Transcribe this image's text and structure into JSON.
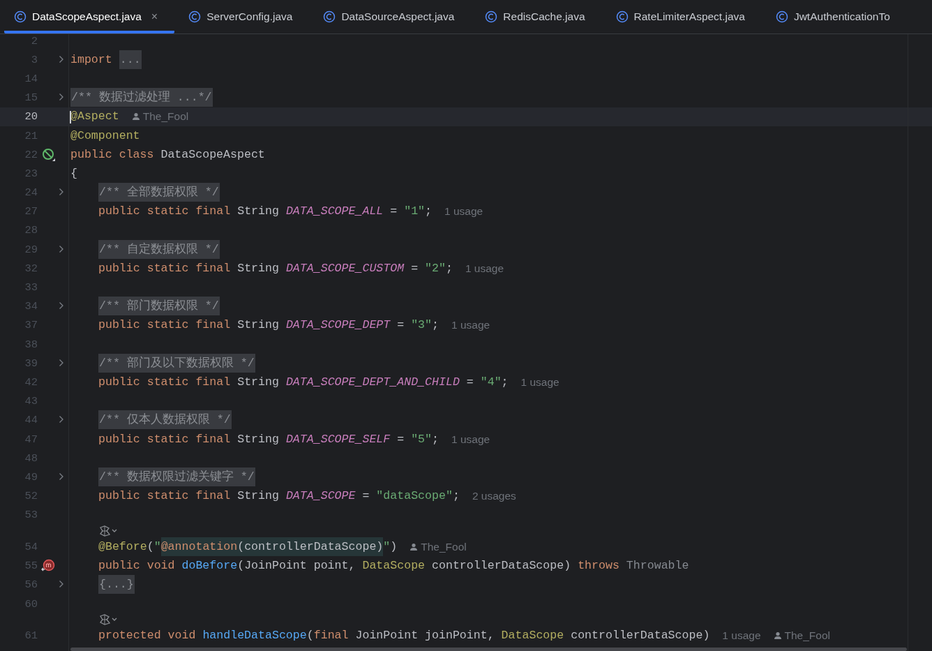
{
  "tabs": [
    {
      "label": "DataScopeAspect.java",
      "selected": true,
      "close": "×"
    },
    {
      "label": "ServerConfig.java",
      "selected": false
    },
    {
      "label": "DataSourceAspect.java",
      "selected": false
    },
    {
      "label": "RedisCache.java",
      "selected": false
    },
    {
      "label": "RateLimiterAspect.java",
      "selected": false
    },
    {
      "label": "JwtAuthenticationTo",
      "selected": false
    }
  ],
  "editor": {
    "lines": [
      {
        "kind": "code",
        "number": "2",
        "current": false
      },
      {
        "kind": "code",
        "number": "3",
        "current": false,
        "indented": false,
        "gutter": {
          "kind": "fold"
        },
        "tokens": [
          {
            "kind": "kw",
            "text": "import "
          },
          {
            "kind": "fold",
            "text": "..."
          }
        ]
      },
      {
        "kind": "code",
        "number": "14",
        "current": false
      },
      {
        "kind": "code",
        "number": "15",
        "current": false,
        "indented": false,
        "gutter": {
          "kind": "fold"
        },
        "tokens": [
          {
            "kind": "fold",
            "text": "/** 数据过滤处理 ...*/"
          }
        ]
      },
      {
        "kind": "code",
        "number": "20",
        "current": true,
        "indented": false,
        "tokens": [
          {
            "kind": "ann",
            "text": "@Aspect"
          },
          {
            "kind": "author",
            "text": "The_Fool"
          }
        ]
      },
      {
        "kind": "code",
        "number": "21",
        "current": false,
        "indented": false,
        "tokens": [
          {
            "kind": "ann",
            "text": "@Component"
          }
        ]
      },
      {
        "kind": "code",
        "number": "22",
        "current": false,
        "indented": false,
        "gutter": {
          "kind": "bean"
        },
        "tokens": [
          {
            "kind": "kw",
            "text": "public class "
          },
          {
            "kind": "plain",
            "text": "DataScopeAspect"
          }
        ]
      },
      {
        "kind": "code",
        "number": "23",
        "current": false,
        "indented": false,
        "tokens": [
          {
            "kind": "plain",
            "text": "{"
          }
        ]
      },
      {
        "kind": "code",
        "number": "24",
        "current": false,
        "indented": true,
        "gutter": {
          "kind": "fold"
        },
        "tokens": [
          {
            "kind": "fold",
            "text": "/** 全部数据权限 */"
          }
        ]
      },
      {
        "kind": "code",
        "number": "27",
        "current": false,
        "indented": true,
        "tokens": [
          {
            "kind": "kw",
            "text": "public static final "
          },
          {
            "kind": "plain",
            "text": "String "
          },
          {
            "kind": "const",
            "text": "DATA_SCOPE_ALL"
          },
          {
            "kind": "plain",
            "text": " = "
          },
          {
            "kind": "str",
            "text": "\"1\""
          },
          {
            "kind": "plain",
            "text": ";"
          },
          {
            "kind": "hint",
            "text": "1 usage"
          }
        ]
      },
      {
        "kind": "code",
        "number": "28",
        "current": false
      },
      {
        "kind": "code",
        "number": "29",
        "current": false,
        "indented": true,
        "gutter": {
          "kind": "fold"
        },
        "tokens": [
          {
            "kind": "fold",
            "text": "/** 自定数据权限 */"
          }
        ]
      },
      {
        "kind": "code",
        "number": "32",
        "current": false,
        "indented": true,
        "tokens": [
          {
            "kind": "kw",
            "text": "public static final "
          },
          {
            "kind": "plain",
            "text": "String "
          },
          {
            "kind": "const",
            "text": "DATA_SCOPE_CUSTOM"
          },
          {
            "kind": "plain",
            "text": " = "
          },
          {
            "kind": "str",
            "text": "\"2\""
          },
          {
            "kind": "plain",
            "text": ";"
          },
          {
            "kind": "hint",
            "text": "1 usage"
          }
        ]
      },
      {
        "kind": "code",
        "number": "33",
        "current": false
      },
      {
        "kind": "code",
        "number": "34",
        "current": false,
        "indented": true,
        "gutter": {
          "kind": "fold"
        },
        "tokens": [
          {
            "kind": "fold",
            "text": "/** 部门数据权限 */"
          }
        ]
      },
      {
        "kind": "code",
        "number": "37",
        "current": false,
        "indented": true,
        "tokens": [
          {
            "kind": "kw",
            "text": "public static final "
          },
          {
            "kind": "plain",
            "text": "String "
          },
          {
            "kind": "const",
            "text": "DATA_SCOPE_DEPT"
          },
          {
            "kind": "plain",
            "text": " = "
          },
          {
            "kind": "str",
            "text": "\"3\""
          },
          {
            "kind": "plain",
            "text": ";"
          },
          {
            "kind": "hint",
            "text": "1 usage"
          }
        ]
      },
      {
        "kind": "code",
        "number": "38",
        "current": false
      },
      {
        "kind": "code",
        "number": "39",
        "current": false,
        "indented": true,
        "gutter": {
          "kind": "fold"
        },
        "tokens": [
          {
            "kind": "fold",
            "text": "/** 部门及以下数据权限 */"
          }
        ]
      },
      {
        "kind": "code",
        "number": "42",
        "current": false,
        "indented": true,
        "tokens": [
          {
            "kind": "kw",
            "text": "public static final "
          },
          {
            "kind": "plain",
            "text": "String "
          },
          {
            "kind": "const",
            "text": "DATA_SCOPE_DEPT_AND_CHILD"
          },
          {
            "kind": "plain",
            "text": " = "
          },
          {
            "kind": "str",
            "text": "\"4\""
          },
          {
            "kind": "plain",
            "text": ";"
          },
          {
            "kind": "hint",
            "text": "1 usage"
          }
        ]
      },
      {
        "kind": "code",
        "number": "43",
        "current": false
      },
      {
        "kind": "code",
        "number": "44",
        "current": false,
        "indented": true,
        "gutter": {
          "kind": "fold"
        },
        "tokens": [
          {
            "kind": "fold",
            "text": "/** 仅本人数据权限 */"
          }
        ]
      },
      {
        "kind": "code",
        "number": "47",
        "current": false,
        "indented": true,
        "tokens": [
          {
            "kind": "kw",
            "text": "public static final "
          },
          {
            "kind": "plain",
            "text": "String "
          },
          {
            "kind": "const",
            "text": "DATA_SCOPE_SELF"
          },
          {
            "kind": "plain",
            "text": " = "
          },
          {
            "kind": "str",
            "text": "\"5\""
          },
          {
            "kind": "plain",
            "text": ";"
          },
          {
            "kind": "hint",
            "text": "1 usage"
          }
        ]
      },
      {
        "kind": "code",
        "number": "48",
        "current": false
      },
      {
        "kind": "code",
        "number": "49",
        "current": false,
        "indented": true,
        "gutter": {
          "kind": "fold"
        },
        "tokens": [
          {
            "kind": "fold",
            "text": "/** 数据权限过滤关键字 */"
          }
        ]
      },
      {
        "kind": "code",
        "number": "52",
        "current": false,
        "indented": true,
        "tokens": [
          {
            "kind": "kw",
            "text": "public static final "
          },
          {
            "kind": "plain",
            "text": "String "
          },
          {
            "kind": "const",
            "text": "DATA_SCOPE"
          },
          {
            "kind": "plain",
            "text": " = "
          },
          {
            "kind": "str",
            "text": "\"dataScope\""
          },
          {
            "kind": "plain",
            "text": ";"
          },
          {
            "kind": "hint",
            "text": "2 usages"
          }
        ]
      },
      {
        "kind": "code",
        "number": "53",
        "current": false
      },
      {
        "kind": "inlay",
        "current": false,
        "indented": true
      },
      {
        "kind": "code",
        "number": "54",
        "current": false,
        "indented": true,
        "tokens": [
          {
            "kind": "ann",
            "text": "@Before"
          },
          {
            "kind": "plain",
            "text": "("
          },
          {
            "kind": "str",
            "text": "\""
          },
          {
            "kind": "injkw",
            "text": "@annotation"
          },
          {
            "kind": "inj",
            "text": "(controllerDataScope)"
          },
          {
            "kind": "str",
            "text": "\""
          },
          {
            "kind": "plain",
            "text": ")"
          },
          {
            "kind": "author",
            "text": "The_Fool"
          }
        ]
      },
      {
        "kind": "code",
        "number": "55",
        "current": false,
        "indented": true,
        "gutter": {
          "kind": "override"
        },
        "tokens": [
          {
            "kind": "kw",
            "text": "public void "
          },
          {
            "kind": "fn",
            "text": "doBefore"
          },
          {
            "kind": "plain",
            "text": "(JoinPoint point, "
          },
          {
            "kind": "type",
            "text": "DataScope"
          },
          {
            "kind": "plain",
            "text": " controllerDataScope) "
          },
          {
            "kind": "kw",
            "text": "throws "
          },
          {
            "kind": "dim",
            "text": "Throwable"
          }
        ]
      },
      {
        "kind": "code",
        "number": "56",
        "current": false,
        "indented": true,
        "gutter": {
          "kind": "fold"
        },
        "tokens": [
          {
            "kind": "fold",
            "text": "{...}"
          }
        ]
      },
      {
        "kind": "code",
        "number": "60",
        "current": false
      },
      {
        "kind": "inlay",
        "current": false,
        "indented": true
      },
      {
        "kind": "code",
        "number": "61",
        "current": false,
        "indented": true,
        "tokens": [
          {
            "kind": "kw",
            "text": "protected void "
          },
          {
            "kind": "fn",
            "text": "handleDataScope"
          },
          {
            "kind": "plain",
            "text": "("
          },
          {
            "kind": "kw",
            "text": "final "
          },
          {
            "kind": "plain",
            "text": "JoinPoint joinPoint, "
          },
          {
            "kind": "type",
            "text": "DataScope"
          },
          {
            "kind": "plain",
            "text": " controllerDataScope)"
          },
          {
            "kind": "hint",
            "text": "1 usage"
          },
          {
            "kind": "author",
            "text": "The_Fool"
          }
        ]
      }
    ]
  }
}
